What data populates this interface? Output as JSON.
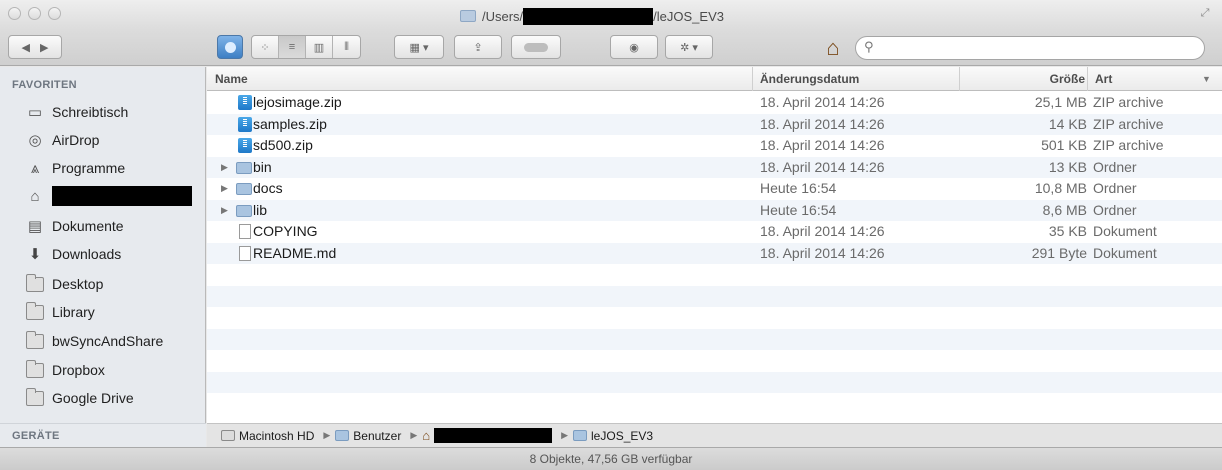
{
  "window": {
    "title_prefix": "/Users/",
    "title_suffix": "/leJOS_EV3"
  },
  "sidebar": {
    "favorites_header": "FAVORITEN",
    "devices_header": "GERÄTE",
    "items": [
      {
        "label": "Schreibtisch",
        "icon": "desktop-icon"
      },
      {
        "label": "AirDrop",
        "icon": "airdrop-icon"
      },
      {
        "label": "Programme",
        "icon": "applications-icon"
      },
      {
        "label": "",
        "icon": "home-icon",
        "redacted": true
      },
      {
        "label": "Dokumente",
        "icon": "documents-icon"
      },
      {
        "label": "Downloads",
        "icon": "downloads-icon"
      },
      {
        "label": "Desktop",
        "icon": "folder-icon"
      },
      {
        "label": "Library",
        "icon": "folder-icon"
      },
      {
        "label": "bwSyncAndShare",
        "icon": "folder-icon"
      },
      {
        "label": "Dropbox",
        "icon": "folder-icon"
      },
      {
        "label": "Google Drive",
        "icon": "folder-icon"
      }
    ]
  },
  "columns": {
    "name": "Name",
    "date": "Änderungsdatum",
    "size": "Größe",
    "kind": "Art"
  },
  "files": [
    {
      "name": "lejosimage.zip",
      "date": "18. April 2014 14:26",
      "size": "25,1 MB",
      "kind": "ZIP archive",
      "type": "zip"
    },
    {
      "name": "samples.zip",
      "date": "18. April 2014 14:26",
      "size": "14 KB",
      "kind": "ZIP archive",
      "type": "zip"
    },
    {
      "name": "sd500.zip",
      "date": "18. April 2014 14:26",
      "size": "501 KB",
      "kind": "ZIP archive",
      "type": "zip"
    },
    {
      "name": "bin",
      "date": "18. April 2014 14:26",
      "size": "13 KB",
      "kind": "Ordner",
      "type": "folder"
    },
    {
      "name": "docs",
      "date": "Heute 16:54",
      "size": "10,8 MB",
      "kind": "Ordner",
      "type": "folder"
    },
    {
      "name": "lib",
      "date": "Heute 16:54",
      "size": "8,6 MB",
      "kind": "Ordner",
      "type": "folder"
    },
    {
      "name": "COPYING",
      "date": "18. April 2014 14:26",
      "size": "35 KB",
      "kind": "Dokument",
      "type": "doc"
    },
    {
      "name": "README.md",
      "date": "18. April 2014 14:26",
      "size": "291 Byte",
      "kind": "Dokument",
      "type": "doc"
    }
  ],
  "pathbar": {
    "disk": "Macintosh HD",
    "users": "Benutzer",
    "current": "leJOS_EV3"
  },
  "status": "8 Objekte, 47,56 GB verfügbar",
  "colors": {
    "sidebar_bg": "#e7eaee",
    "stripe": "#f1f5fa"
  }
}
